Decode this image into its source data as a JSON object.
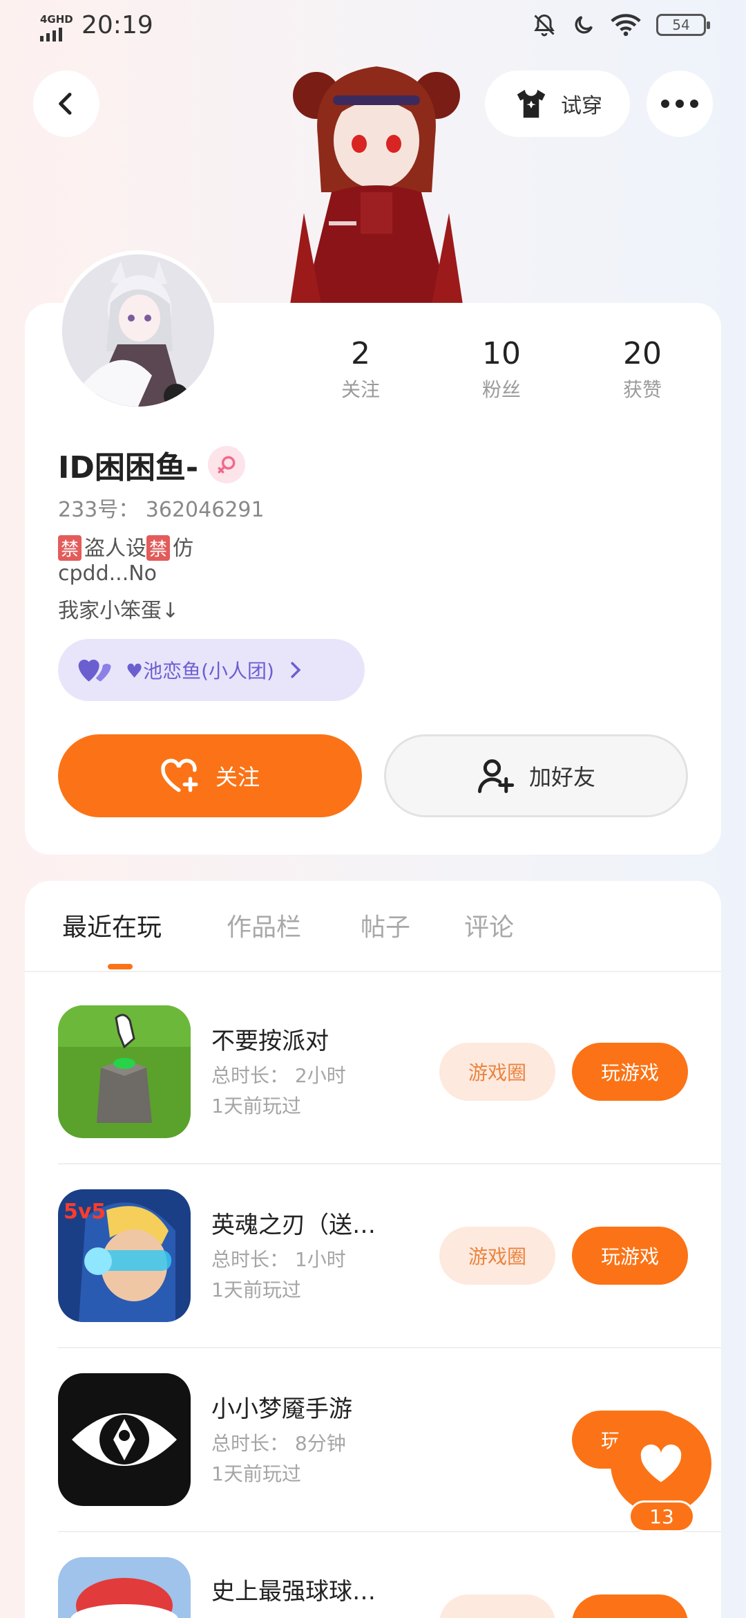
{
  "status_bar": {
    "network": "4GHD",
    "time": "20:19",
    "battery": "54"
  },
  "header": {
    "tryon_label": "试穿"
  },
  "profile": {
    "stats": [
      {
        "num": "2",
        "label": "关注"
      },
      {
        "num": "10",
        "label": "粉丝"
      },
      {
        "num": "20",
        "label": "获赞"
      }
    ],
    "name": "ID困困鱼-",
    "uid": "233号： 362046291",
    "bio_tag": "禁",
    "bio_line1_mid": "盗人设",
    "bio_line1_end": "仿",
    "bio_line2": "cpdd...No",
    "bio_line3": "我家小笨蛋↓",
    "fan_group": "♥池恋鱼(小人团)",
    "follow_label": "关注",
    "add_friend_label": "加好友"
  },
  "tabs": [
    "最近在玩",
    "作品栏",
    "帖子",
    "评论"
  ],
  "games": [
    {
      "name": "不要按派对",
      "duration": "总时长： 2小时",
      "last_played": "1天前玩过"
    },
    {
      "name": "英魂之刃（送…",
      "duration": "总时长： 1小时",
      "last_played": "1天前玩过"
    },
    {
      "name": "小小梦魇手游",
      "duration": "总时长： 8分钟",
      "last_played": "1天前玩过"
    },
    {
      "name": "史上最强球球…"
    }
  ],
  "game_buttons": {
    "circle": "游戏圈",
    "play": "玩游戏"
  },
  "float_like": {
    "count": "13"
  },
  "colors": {
    "accent": "#fb7316",
    "fan_purple": "#6b5fd0"
  }
}
